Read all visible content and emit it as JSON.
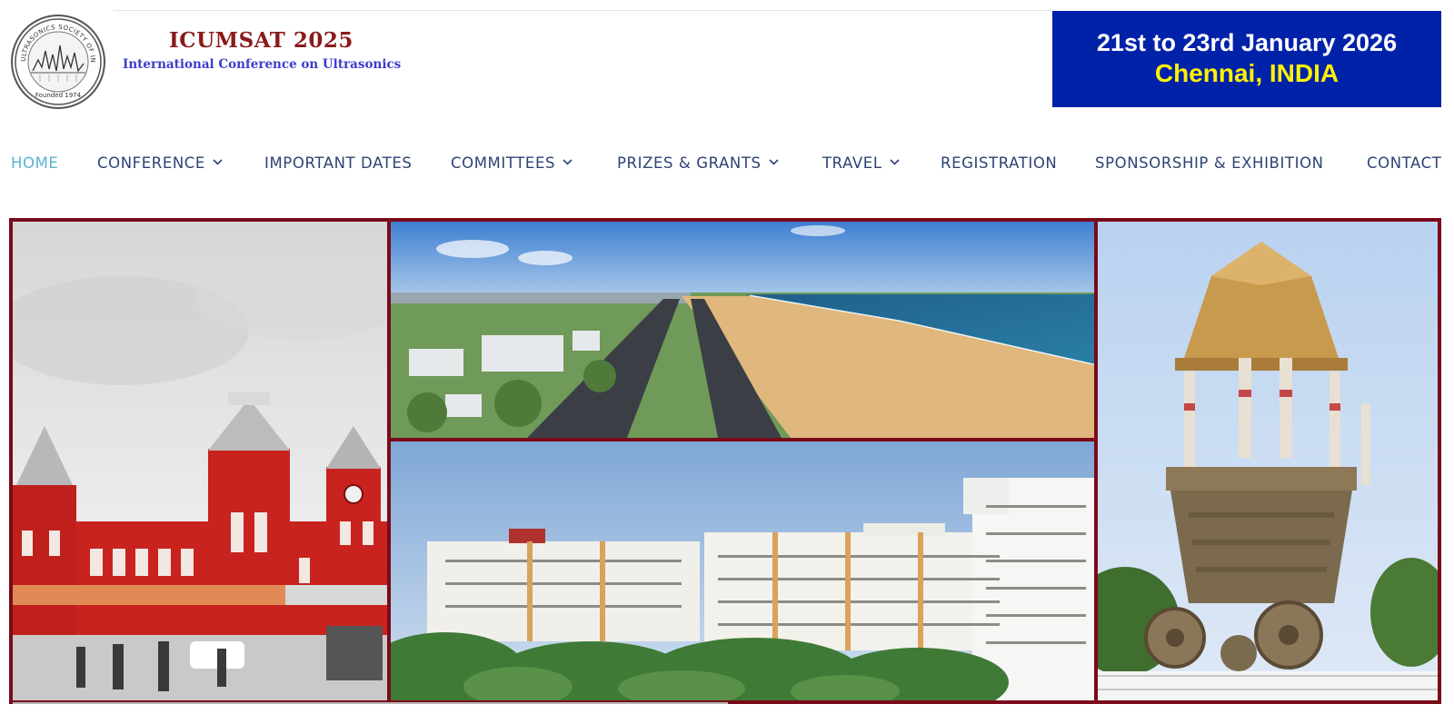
{
  "header": {
    "logo": {
      "ring_text": "ULTRASONICS SOCIETY OF INDIA",
      "founded_text": "Founded 1974"
    },
    "title": "ICUMSAT 2025",
    "subtitle": "International Conference on Ultrasonics",
    "banner": {
      "dates": "21st to 23rd January 2026",
      "location": "Chennai, INDIA"
    }
  },
  "nav": {
    "items": [
      {
        "label": "HOME",
        "has_dropdown": false,
        "active": true
      },
      {
        "label": "CONFERENCE",
        "has_dropdown": true,
        "active": false
      },
      {
        "label": "IMPORTANT DATES",
        "has_dropdown": false,
        "active": false
      },
      {
        "label": "COMMITTEES",
        "has_dropdown": true,
        "active": false
      },
      {
        "label": "PRIZES & GRANTS",
        "has_dropdown": true,
        "active": false
      },
      {
        "label": "TRAVEL",
        "has_dropdown": true,
        "active": false
      },
      {
        "label": "REGISTRATION",
        "has_dropdown": false,
        "active": false
      },
      {
        "label": "SPONSORSHIP & EXHIBITION",
        "has_dropdown": false,
        "active": false
      },
      {
        "label": "CONTACT",
        "has_dropdown": false,
        "active": false
      }
    ]
  },
  "hero": {
    "tiles": [
      {
        "name": "chennai-central-station-photo"
      },
      {
        "name": "marina-beach-aerial-photo"
      },
      {
        "name": "campus-buildings-photo"
      },
      {
        "name": "valluvar-kottam-chariot-photo"
      }
    ]
  },
  "colors": {
    "title": "#8b1a1a",
    "subtitle": "#3c3ccc",
    "banner_bg": "#0022a8",
    "banner_date": "#ffffff",
    "banner_location": "#fff200",
    "nav_text": "#2d4373",
    "nav_active": "#5ab3cf",
    "hero_border": "#7a0a1a"
  }
}
